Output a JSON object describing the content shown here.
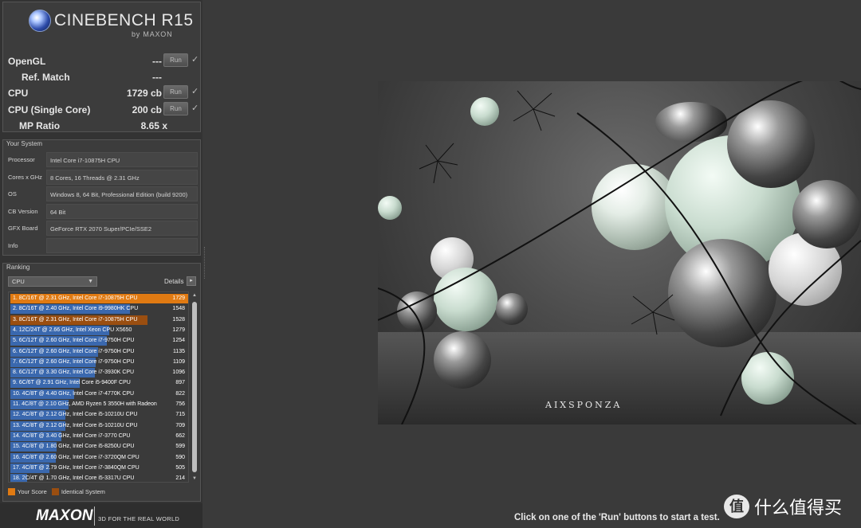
{
  "app": {
    "title": "CINEBENCH R15",
    "subtitle": "by MAXON"
  },
  "results": [
    {
      "label": "OpenGL",
      "value": "---",
      "has_run": true,
      "check": "✓"
    },
    {
      "label": "Ref. Match",
      "value": "---",
      "has_run": false
    },
    {
      "label": "CPU",
      "value": "1729 cb",
      "has_run": true,
      "check": "✓"
    },
    {
      "label": "CPU (Single Core)",
      "value": "200 cb",
      "has_run": true,
      "check": "✓"
    },
    {
      "label": "MP Ratio",
      "value": "8.65 x",
      "has_run": false
    }
  ],
  "run_label": "Run",
  "system": {
    "title": "Your System",
    "rows": [
      {
        "label": "Processor",
        "value": "Intel Core i7-10875H CPU"
      },
      {
        "label": "Cores x GHz",
        "value": "8 Cores, 16 Threads @ 2.31 GHz"
      },
      {
        "label": "OS",
        "value": "Windows 8, 64 Bit, Professional Edition (build 9200)"
      },
      {
        "label": "CB Version",
        "value": "64 Bit"
      },
      {
        "label": "GFX Board",
        "value": "GeForce RTX 2070 Super/PCIe/SSE2"
      },
      {
        "label": "Info",
        "value": ""
      }
    ]
  },
  "ranking": {
    "title": "Ranking",
    "select_value": "CPU",
    "details_label": "Details",
    "max_score": 1729,
    "rows": [
      {
        "text": "1. 8C/16T @ 2.31 GHz, Intel Core i7-10875H CPU",
        "score": 1729,
        "kind": "your"
      },
      {
        "text": "2. 8C/16T @ 2.40 GHz, Intel Core i9-9980HK CPU",
        "score": 1548,
        "kind": "normal"
      },
      {
        "text": "3. 8C/16T @ 2.31 GHz, Intel Core i7-10875H CPU",
        "score": 1528,
        "kind": "identical"
      },
      {
        "text": "4. 12C/24T @ 2.66 GHz, Intel Xeon CPU X5650",
        "score": 1279,
        "kind": "normal"
      },
      {
        "text": "5. 6C/12T @ 2.60 GHz, Intel Core i7-9750H CPU",
        "score": 1254,
        "kind": "normal"
      },
      {
        "text": "6. 6C/12T @ 2.60 GHz, Intel Core i7-9750H CPU",
        "score": 1135,
        "kind": "normal"
      },
      {
        "text": "7. 6C/12T @ 2.60 GHz, Intel Core i7-9750H CPU",
        "score": 1109,
        "kind": "normal"
      },
      {
        "text": "8. 6C/12T @ 3.30 GHz,  Intel Core i7-3930K CPU",
        "score": 1096,
        "kind": "normal"
      },
      {
        "text": "9. 6C/6T @ 2.91 GHz, Intel Core i5-9400F CPU",
        "score": 897,
        "kind": "normal"
      },
      {
        "text": "10. 4C/8T @ 4.40 GHz, Intel Core i7-4770K CPU",
        "score": 822,
        "kind": "normal"
      },
      {
        "text": "11. 4C/8T @ 2.10 GHz, AMD Ryzen 5 3550H with Radeon",
        "score": 756,
        "kind": "normal"
      },
      {
        "text": "12. 4C/8T @ 2.12 GHz, Intel Core i5-10210U CPU",
        "score": 715,
        "kind": "normal"
      },
      {
        "text": "13. 4C/8T @ 2.12 GHz, Intel Core i5-10210U CPU",
        "score": 709,
        "kind": "normal"
      },
      {
        "text": "14. 4C/8T @ 3.40 GHz,  Intel Core i7-3770 CPU",
        "score": 662,
        "kind": "normal"
      },
      {
        "text": "15. 4C/8T @ 1.80 GHz, Intel Core i5-8250U CPU",
        "score": 599,
        "kind": "normal"
      },
      {
        "text": "16. 4C/8T @ 2.60 GHz, Intel Core i7-3720QM CPU",
        "score": 590,
        "kind": "normal"
      },
      {
        "text": "17. 4C/8T @ 2.79 GHz,  Intel Core i7-3840QM CPU",
        "score": 505,
        "kind": "normal"
      },
      {
        "text": "18. 2C/4T @ 1.70 GHz,  Intel Core i5-3317U CPU",
        "score": 214,
        "kind": "normal"
      }
    ],
    "legend": {
      "your_score": "Your Score",
      "identical": "Identical System"
    }
  },
  "colors": {
    "your": "#e07a12",
    "identical": "#9a4e10",
    "normal": "#3a68ae"
  },
  "footer": {
    "brand": "MAXON",
    "tagline": "3D FOR THE REAL WORLD"
  },
  "render": {
    "credit": "AIXSPONZA"
  },
  "status": "Click on one of the 'Run' buttons to start a test.",
  "watermark": {
    "icon": "值",
    "text": "什么值得买"
  }
}
